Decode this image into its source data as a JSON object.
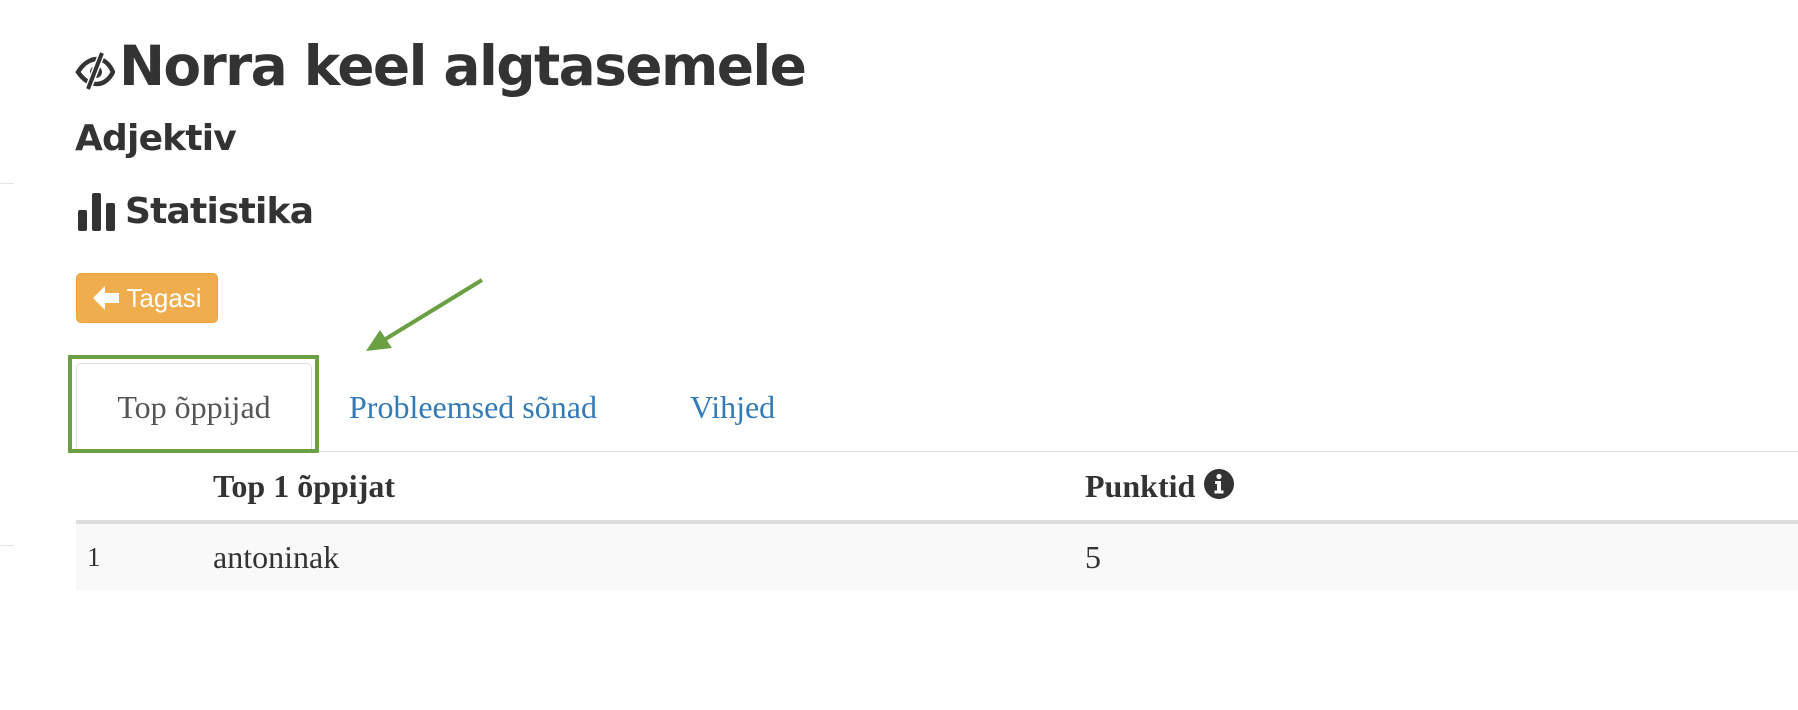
{
  "page": {
    "title": "Norra keel algtasemele",
    "subtitle": "Adjektiv",
    "stats_heading": "Statistika"
  },
  "actions": {
    "back_label": "Tagasi"
  },
  "tabs": [
    {
      "label": "Top õppijad",
      "active": true
    },
    {
      "label": "Probleemsed sõnad",
      "active": false
    },
    {
      "label": "Vihjed",
      "active": false
    }
  ],
  "table": {
    "headers": {
      "rank": "",
      "learner": "Top 1 õppijat",
      "points": "Punktid"
    },
    "rows": [
      {
        "rank": "1",
        "learner": "antoninak",
        "points": "5"
      }
    ]
  },
  "colors": {
    "back_button": "#f0ad4e",
    "link": "#337ab7",
    "annotation": "#6aa043",
    "text": "#333333"
  },
  "icons": {
    "title": "eye-slash-icon",
    "stats": "bar-chart-icon",
    "back": "arrow-left-icon",
    "points_info": "info-circle-icon",
    "annotation": "annotation-arrow-icon"
  }
}
